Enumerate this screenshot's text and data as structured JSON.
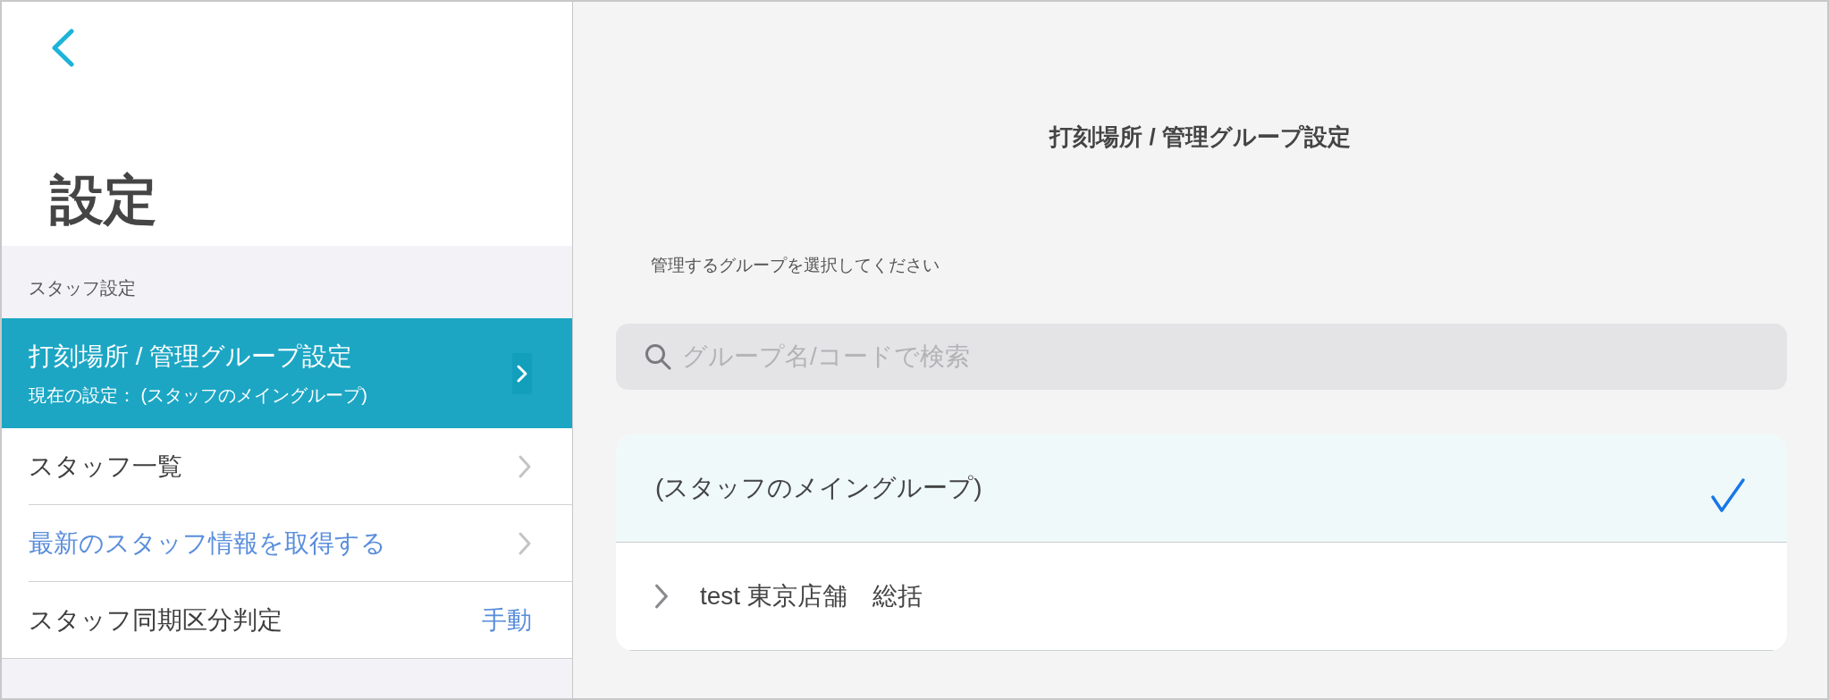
{
  "sidebar": {
    "title": "設定",
    "section_header": "スタッフ設定",
    "items": [
      {
        "kind": "nav",
        "label": "打刻場所 / 管理グループ設定",
        "detail": "現在の設定： (スタッフのメイングループ)",
        "selected": true
      },
      {
        "kind": "nav",
        "label": "スタッフ一覧",
        "selected": false
      },
      {
        "kind": "action",
        "label": "最新のスタッフ情報を取得する",
        "selected": false
      },
      {
        "kind": "value",
        "label": "スタッフ同期区分判定",
        "value": "手動",
        "selected": false
      }
    ]
  },
  "detail": {
    "title": "打刻場所 / 管理グループ設定",
    "instruction": "管理するグループを選択してください",
    "search": {
      "placeholder": "グループ名/コードで検索"
    },
    "groups": [
      {
        "name": "(スタッフのメイングループ)",
        "expandable": false,
        "selected": true
      },
      {
        "name": "test 東京店舗　総括",
        "expandable": true,
        "selected": false
      }
    ]
  }
}
